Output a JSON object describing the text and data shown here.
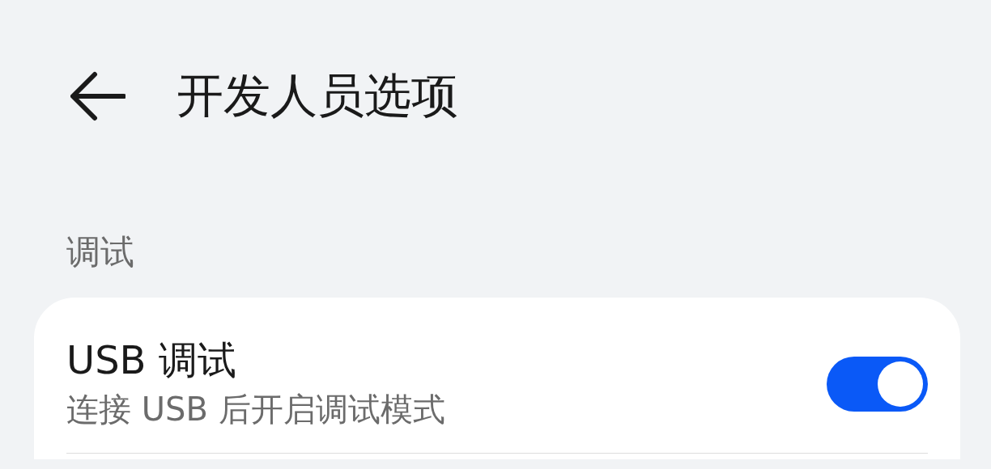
{
  "header": {
    "title": "开发人员选项"
  },
  "section": {
    "label": "调试",
    "items": [
      {
        "title": "USB 调试",
        "subtitle": "连接 USB 后开启调试模式",
        "on": true
      }
    ]
  }
}
